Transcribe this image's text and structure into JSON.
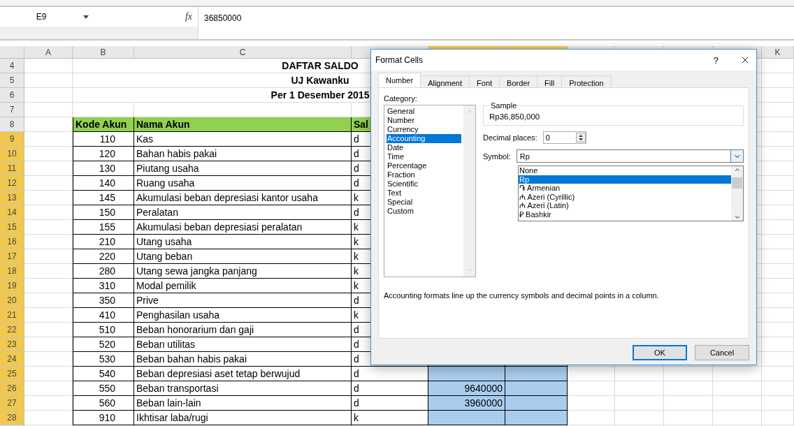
{
  "formula_bar": {
    "name_box": "E9",
    "fx": "fx",
    "value": "36850000"
  },
  "columns": [
    {
      "letter": "A",
      "selected": false
    },
    {
      "letter": "B",
      "selected": false
    },
    {
      "letter": "C",
      "selected": false
    },
    {
      "selected": false
    },
    {
      "selected": true
    },
    {
      "selected": true
    },
    {
      "selected": false
    },
    {
      "selected": false
    },
    {
      "selected": false
    },
    {
      "selected": false
    },
    {
      "letter": "K",
      "selected": false
    }
  ],
  "rows": [
    {
      "num": "4",
      "selected": false,
      "kind": "title",
      "text": "DAFTAR SALDO"
    },
    {
      "num": "5",
      "selected": false,
      "kind": "title",
      "text": "UJ Kawanku"
    },
    {
      "num": "6",
      "selected": false,
      "kind": "title",
      "text": "Per 1 Desember 2015"
    },
    {
      "num": "7",
      "selected": false,
      "kind": "blank"
    },
    {
      "num": "8",
      "selected": false,
      "kind": "header",
      "code": "Kode Akun",
      "name": "Nama Akun",
      "dc": "Sal"
    },
    {
      "num": "9",
      "selected": true,
      "kind": "account",
      "code": "110",
      "name": "Kas",
      "dc": "d"
    },
    {
      "num": "10",
      "selected": true,
      "kind": "account",
      "code": "120",
      "name": "Bahan habis pakai",
      "dc": "d"
    },
    {
      "num": "11",
      "selected": true,
      "kind": "account",
      "code": "130",
      "name": "Piutang usaha",
      "dc": "d"
    },
    {
      "num": "12",
      "selected": true,
      "kind": "account",
      "code": "140",
      "name": "Ruang usaha",
      "dc": "d"
    },
    {
      "num": "13",
      "selected": true,
      "kind": "account",
      "code": "145",
      "name": "Akumulasi beban depresiasi kantor usaha",
      "dc": "k"
    },
    {
      "num": "14",
      "selected": true,
      "kind": "account",
      "code": "150",
      "name": "Peralatan",
      "dc": "d"
    },
    {
      "num": "15",
      "selected": true,
      "kind": "account",
      "code": "155",
      "name": "Akumulasi beban depresiasi peralatan",
      "dc": "k"
    },
    {
      "num": "16",
      "selected": true,
      "kind": "account",
      "code": "210",
      "name": "Utang usaha",
      "dc": "k"
    },
    {
      "num": "17",
      "selected": true,
      "kind": "account",
      "code": "220",
      "name": "Utang beban",
      "dc": "k"
    },
    {
      "num": "18",
      "selected": true,
      "kind": "account",
      "code": "280",
      "name": "Utang sewa jangka panjang",
      "dc": "k"
    },
    {
      "num": "19",
      "selected": true,
      "kind": "account",
      "code": "310",
      "name": "Modal pemilik",
      "dc": "k"
    },
    {
      "num": "20",
      "selected": true,
      "kind": "account",
      "code": "350",
      "name": "Prive",
      "dc": "d"
    },
    {
      "num": "21",
      "selected": true,
      "kind": "account",
      "code": "410",
      "name": "Penghasilan usaha",
      "dc": "k"
    },
    {
      "num": "22",
      "selected": true,
      "kind": "account",
      "code": "510",
      "name": "Beban honorarium dan gaji",
      "dc": "d"
    },
    {
      "num": "23",
      "selected": true,
      "kind": "account",
      "code": "520",
      "name": "Beban utilitas",
      "dc": "d"
    },
    {
      "num": "24",
      "selected": true,
      "kind": "account",
      "code": "530",
      "name": "Beban bahan habis pakai",
      "dc": "d"
    },
    {
      "num": "25",
      "selected": true,
      "kind": "account",
      "code": "540",
      "name": "Beban depresiasi aset tetap berwujud",
      "dc": "d"
    },
    {
      "num": "26",
      "selected": true,
      "kind": "account",
      "code": "550",
      "name": "Beban transportasi",
      "dc": "d",
      "saldo": "9640000"
    },
    {
      "num": "27",
      "selected": true,
      "kind": "account",
      "code": "560",
      "name": "Beban lain-lain",
      "dc": "d",
      "saldo": "3960000"
    },
    {
      "num": "28",
      "selected": true,
      "kind": "account",
      "code": "910",
      "name": "Ikhtisar laba/rugi",
      "dc": "k"
    }
  ],
  "dialog": {
    "title": "Format Cells",
    "help": "?",
    "tabs": [
      {
        "label": "Number",
        "selected": true
      },
      {
        "label": "Alignment",
        "selected": false
      },
      {
        "label": "Font",
        "selected": false
      },
      {
        "label": "Border",
        "selected": false
      },
      {
        "label": "Fill",
        "selected": false
      },
      {
        "label": "Protection",
        "selected": false
      }
    ],
    "category_label": "Category:",
    "categories": [
      {
        "label": "General",
        "selected": false
      },
      {
        "label": "Number",
        "selected": false
      },
      {
        "label": "Currency",
        "selected": false
      },
      {
        "label": "Accounting",
        "selected": true
      },
      {
        "label": "Date",
        "selected": false
      },
      {
        "label": "Time",
        "selected": false
      },
      {
        "label": "Percentage",
        "selected": false
      },
      {
        "label": "Fraction",
        "selected": false
      },
      {
        "label": "Scientific",
        "selected": false
      },
      {
        "label": "Text",
        "selected": false
      },
      {
        "label": "Special",
        "selected": false
      },
      {
        "label": "Custom",
        "selected": false
      }
    ],
    "sample_label": "Sample",
    "sample_value": "Rp36,850,000",
    "decimal_label": "Decimal places:",
    "decimal_value": "0",
    "symbol_label": "Symbol:",
    "symbol_value": "Rp",
    "symbol_options": [
      {
        "label": "None",
        "selected": false
      },
      {
        "label": "Rp",
        "selected": true
      },
      {
        "label": "֏ Armenian",
        "selected": false
      },
      {
        "label": "₼ Azeri (Cyrillic)",
        "selected": false
      },
      {
        "label": "₼ Azeri (Latin)",
        "selected": false
      },
      {
        "label": "₽ Bashkir",
        "selected": false
      }
    ],
    "description": "Accounting formats line up the currency symbols and decimal points in a column.",
    "buttons": [
      {
        "label": "OK",
        "kind": "default"
      },
      {
        "label": "Cancel",
        "kind": "normal"
      }
    ]
  }
}
